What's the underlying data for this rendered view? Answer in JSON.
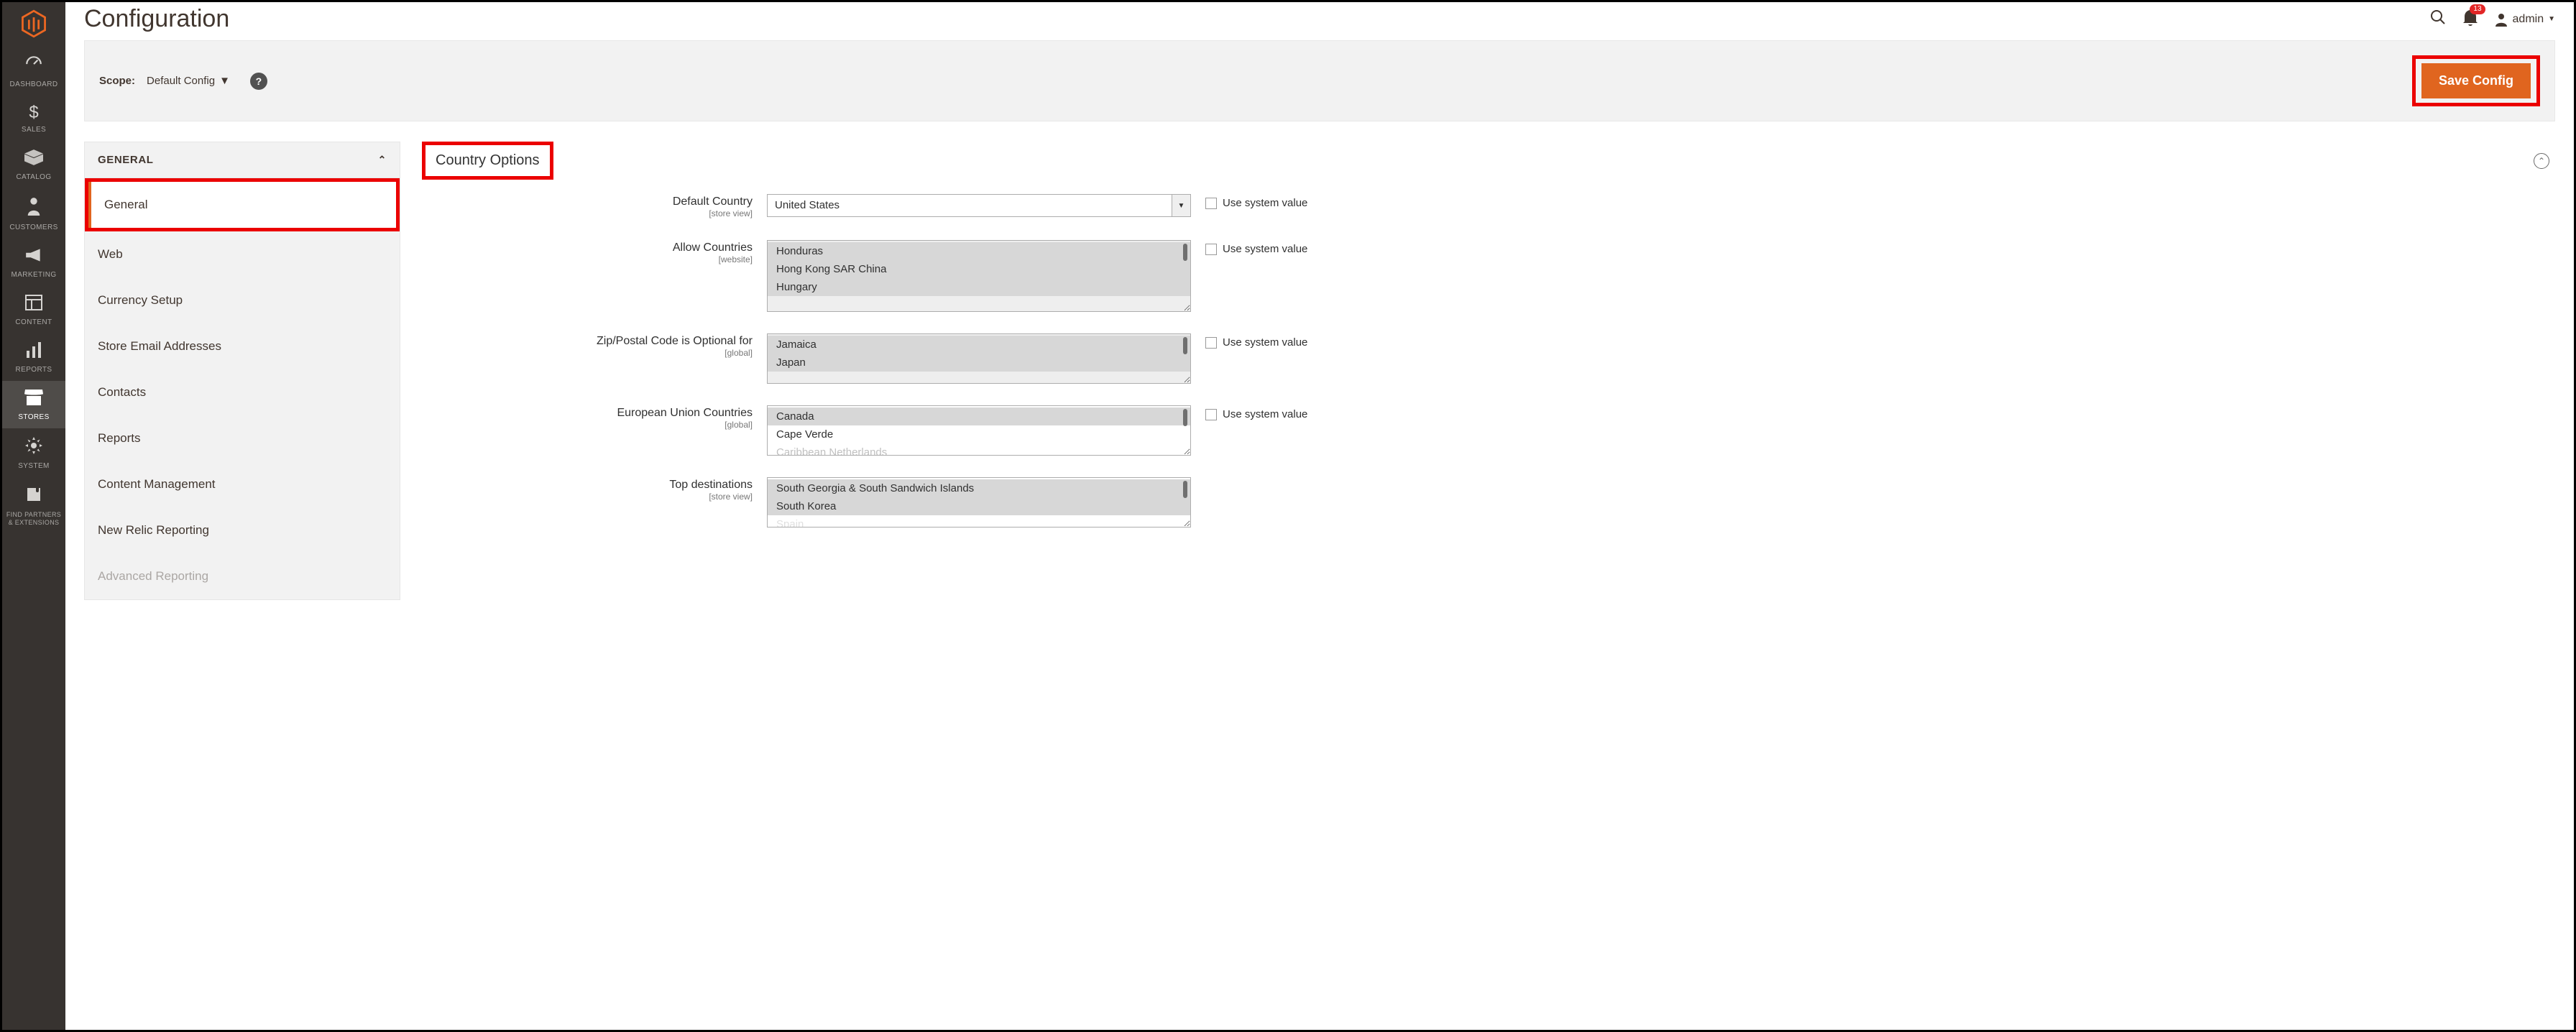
{
  "colors": {
    "accent": "#e0651f",
    "highlight": "#eb0000"
  },
  "nav": {
    "items": [
      {
        "id": "dashboard",
        "label": "DASHBOARD",
        "icon": "gauge"
      },
      {
        "id": "sales",
        "label": "SALES",
        "icon": "dollar"
      },
      {
        "id": "catalog",
        "label": "CATALOG",
        "icon": "box"
      },
      {
        "id": "customers",
        "label": "CUSTOMERS",
        "icon": "person"
      },
      {
        "id": "marketing",
        "label": "MARKETING",
        "icon": "megaphone"
      },
      {
        "id": "content",
        "label": "CONTENT",
        "icon": "layout"
      },
      {
        "id": "reports",
        "label": "REPORTS",
        "icon": "chart"
      },
      {
        "id": "stores",
        "label": "STORES",
        "icon": "store",
        "active": true
      },
      {
        "id": "system",
        "label": "SYSTEM",
        "icon": "gear"
      },
      {
        "id": "partners",
        "label": "FIND PARTNERS & EXTENSIONS",
        "icon": "puzzle",
        "small": true
      }
    ]
  },
  "header": {
    "title": "Configuration",
    "notif_count": "13",
    "user": "admin"
  },
  "scope": {
    "label": "Scope:",
    "value": "Default Config"
  },
  "save_label": "Save Config",
  "panel": {
    "category": "GENERAL",
    "items": [
      "General",
      "Web",
      "Currency Setup",
      "Store Email Addresses",
      "Contacts",
      "Reports",
      "Content Management",
      "New Relic Reporting",
      "Advanced Reporting"
    ]
  },
  "section_title": "Country Options",
  "fields": {
    "default_country": {
      "label": "Default Country",
      "scope": "[store view]",
      "value": "United States"
    },
    "allow_countries": {
      "label": "Allow Countries",
      "scope": "[website]",
      "options": [
        "Honduras",
        "Hong Kong SAR China",
        "Hungary"
      ]
    },
    "zip_optional": {
      "label": "Zip/Postal Code is Optional for",
      "scope": "[global]",
      "options": [
        "Jamaica",
        "Japan"
      ]
    },
    "eu_countries": {
      "label": "European Union Countries",
      "scope": "[global]",
      "options": [
        "Canada",
        "Cape Verde",
        "Caribbean Netherlands"
      ],
      "selected": [
        "Canada"
      ]
    },
    "top_destinations": {
      "label": "Top destinations",
      "scope": "[store view]",
      "options": [
        "South Georgia & South Sandwich Islands",
        "South Korea",
        "Spain"
      ],
      "selected": [
        "South Georgia & South Sandwich Islands",
        "South Korea"
      ]
    }
  },
  "use_system_label": "Use system value"
}
